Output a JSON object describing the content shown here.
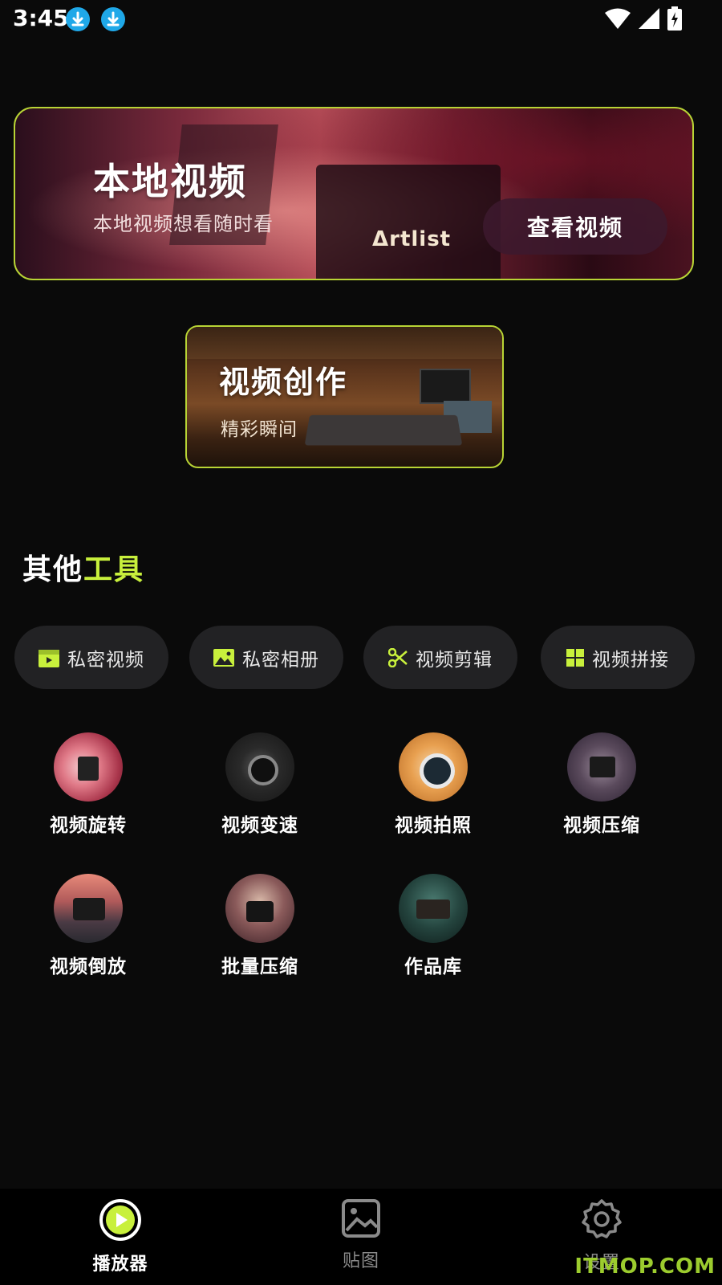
{
  "status_bar": {
    "time": "3:45"
  },
  "banner": {
    "title": "本地视频",
    "subtitle": "本地视频想看随时看",
    "brand_text": "Δrtlist",
    "button_label": "查看视频"
  },
  "creation_card": {
    "title": "视频创作",
    "subtitle": "精彩瞬间"
  },
  "section": {
    "title_part1": "其他",
    "title_part2": "工具"
  },
  "pills": [
    {
      "label": "私密视频",
      "icon": "video-folder-icon"
    },
    {
      "label": "私密相册",
      "icon": "photo-icon"
    },
    {
      "label": "视频剪辑",
      "icon": "scissors-icon"
    },
    {
      "label": "视频拼接",
      "icon": "grid-icon"
    }
  ],
  "tools": [
    {
      "label": "视频旋转"
    },
    {
      "label": "视频变速"
    },
    {
      "label": "视频拍照"
    },
    {
      "label": "视频压缩"
    },
    {
      "label": "视频倒放"
    },
    {
      "label": "批量压缩"
    },
    {
      "label": "作品库"
    }
  ],
  "bottom_nav": {
    "items": [
      {
        "label": "播放器",
        "active": true
      },
      {
        "label": "贴图",
        "active": false
      },
      {
        "label": "设置",
        "active": false
      }
    ]
  },
  "watermark": "ITMOP.COM",
  "colors": {
    "accent": "#c8f03c",
    "border": "#b8d435",
    "background": "#0a0a0a",
    "pill": "#222224"
  }
}
